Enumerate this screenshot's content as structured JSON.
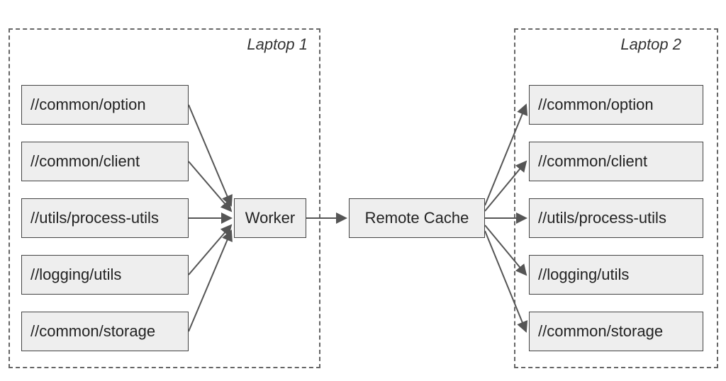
{
  "laptop1": {
    "title": "Laptop 1",
    "nodes": [
      "//common/option",
      "//common/client",
      "//utils/process-utils",
      "//logging/utils",
      "//common/storage"
    ],
    "worker": "Worker"
  },
  "center": {
    "remote_cache": "Remote Cache"
  },
  "laptop2": {
    "title": "Laptop 2",
    "nodes": [
      "//common/option",
      "//common/client",
      "//utils/process-utils",
      "//logging/utils",
      "//common/storage"
    ]
  }
}
